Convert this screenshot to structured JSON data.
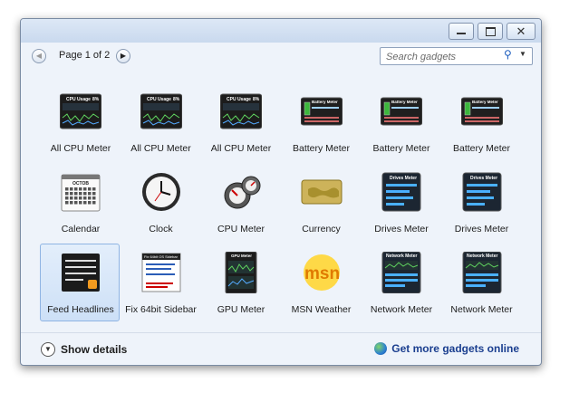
{
  "pager": {
    "label": "Page 1 of 2",
    "prev_icon": "◀",
    "next_icon": "▶"
  },
  "search": {
    "placeholder": "Search gadgets"
  },
  "gadgets": [
    {
      "label": "All CPU Meter",
      "icon": "all-cpu-meter-icon"
    },
    {
      "label": "All CPU Meter",
      "icon": "all-cpu-meter-icon"
    },
    {
      "label": "All CPU Meter",
      "icon": "all-cpu-meter-icon"
    },
    {
      "label": "Battery Meter",
      "icon": "battery-meter-icon"
    },
    {
      "label": "Battery Meter",
      "icon": "battery-meter-icon"
    },
    {
      "label": "Battery Meter",
      "icon": "battery-meter-icon"
    },
    {
      "label": "Calendar",
      "icon": "calendar-icon"
    },
    {
      "label": "Clock",
      "icon": "clock-icon"
    },
    {
      "label": "CPU Meter",
      "icon": "cpu-meter-icon"
    },
    {
      "label": "Currency",
      "icon": "currency-icon"
    },
    {
      "label": "Drives Meter",
      "icon": "drives-meter-icon"
    },
    {
      "label": "Drives Meter",
      "icon": "drives-meter-icon"
    },
    {
      "label": "Feed Headlines",
      "icon": "feed-headlines-icon",
      "selected": true
    },
    {
      "label": "Fix 64bit Sidebar",
      "icon": "fix-64bit-sidebar-icon"
    },
    {
      "label": "GPU Meter",
      "icon": "gpu-meter-icon"
    },
    {
      "label": "MSN Weather",
      "icon": "msn-weather-icon"
    },
    {
      "label": "Network Meter",
      "icon": "network-meter-icon"
    },
    {
      "label": "Network Meter",
      "icon": "network-meter-icon"
    }
  ],
  "thumb_text": {
    "cpu_title": "CPU Usage",
    "cpu_pct": "8%",
    "battery_title": "Battery Meter",
    "drives_title": "Drive Meter",
    "drives_title2": "Drives Meter",
    "gpu_title": "GPU Meter",
    "network_title": "Network Meter",
    "calendar_month": "OCTOB",
    "fix_title": "Fix 64bit OS Sidebar",
    "msn": "msn"
  },
  "footer": {
    "show_details": "Show details",
    "get_more": "Get more gadgets online"
  },
  "colors": {
    "window_bg": "#eef3fa",
    "link": "#1a3e8f",
    "selected_tile": "#cde0f7"
  }
}
